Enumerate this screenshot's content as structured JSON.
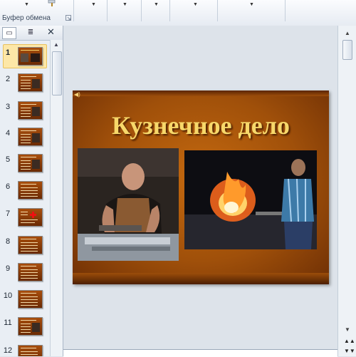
{
  "ribbon": {
    "clipboard_label": "Буфер обмена",
    "launcher_icon": "dialog-launcher-icon",
    "dropdown_arrow": "▼"
  },
  "pane": {
    "tabs": [
      {
        "name": "slides-tab-icon",
        "glyph": "▭"
      },
      {
        "name": "outline-tab-icon",
        "glyph": "≣"
      }
    ],
    "close_glyph": "✕",
    "slides": [
      {
        "number": "1"
      },
      {
        "number": "2"
      },
      {
        "number": "3"
      },
      {
        "number": "4"
      },
      {
        "number": "5"
      },
      {
        "number": "6"
      },
      {
        "number": "7"
      },
      {
        "number": "8"
      },
      {
        "number": "9"
      },
      {
        "number": "10"
      },
      {
        "number": "11"
      },
      {
        "number": "12"
      }
    ],
    "selected_slide": "1"
  },
  "slide": {
    "title": "Кузнечное дело",
    "title_color": "#f7d86a",
    "background_color": "#a0500a"
  },
  "scroll": {
    "up_glyph": "▲",
    "down_glyph": "▼",
    "prev_glyph": "▲▲",
    "next_glyph": "▼▼"
  }
}
